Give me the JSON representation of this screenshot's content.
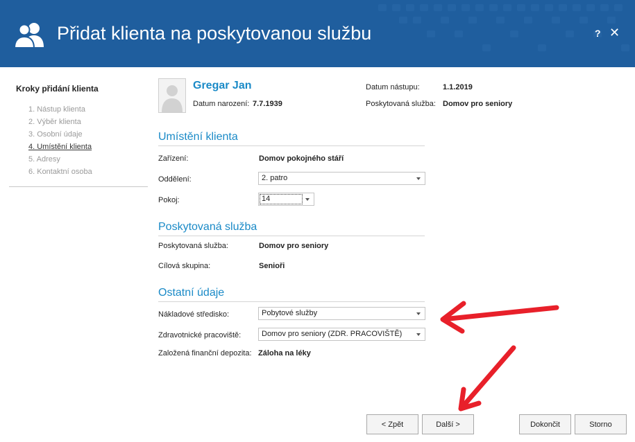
{
  "header": {
    "title": "Přidat klienta na poskytovanou službu",
    "help_label": "?",
    "close_label": "✕",
    "icon": "users-icon",
    "background_color": "#1f5e9e"
  },
  "steps": {
    "title": "Kroky přidání klienta",
    "items": [
      {
        "label": "1. Nástup klienta",
        "active": false
      },
      {
        "label": "2. Výběr klienta",
        "active": false
      },
      {
        "label": "3. Osobní údaje",
        "active": false
      },
      {
        "label": "4. Umístění klienta",
        "active": true
      },
      {
        "label": "5. Adresy",
        "active": false
      },
      {
        "label": "6. Kontaktní osoba",
        "active": false
      }
    ]
  },
  "client": {
    "name": "Gregar Jan",
    "birth_label": "Datum narození:",
    "birth_value": "7.7.1939",
    "start_label": "Datum nástupu:",
    "start_value": "1.1.2019",
    "service_label": "Poskytovaná služba:",
    "service_value": "Domov pro seniory",
    "photo_icon": "person-silhouette-icon"
  },
  "placement": {
    "title": "Umístění klienta",
    "facility_label": "Zařízení:",
    "facility_value": "Domov pokojného stáří",
    "department_label": "Oddělení:",
    "department_value": "2. patro",
    "room_label": "Pokoj:",
    "room_value": "14"
  },
  "service": {
    "title": "Poskytovaná služba",
    "service_label": "Poskytovaná služba:",
    "service_value": "Domov pro seniory",
    "target_label": "Cílová skupina:",
    "target_value": "Senioři"
  },
  "other": {
    "title": "Ostatní údaje",
    "cost_center_label": "Nákladové středisko:",
    "cost_center_value": "Pobytové služby",
    "health_label": "Zdravotnické pracoviště:",
    "health_value": "Domov pro seniory (ZDR. PRACOVIŠTĚ)",
    "deposit_label": "Založená finanční depozita:",
    "deposit_value": "Záloha na léky"
  },
  "buttons": {
    "back": "< Zpět",
    "next": "Další >",
    "finish": "Dokončit",
    "cancel": "Storno"
  },
  "annotation": {
    "arrow_color": "#e8202a"
  }
}
